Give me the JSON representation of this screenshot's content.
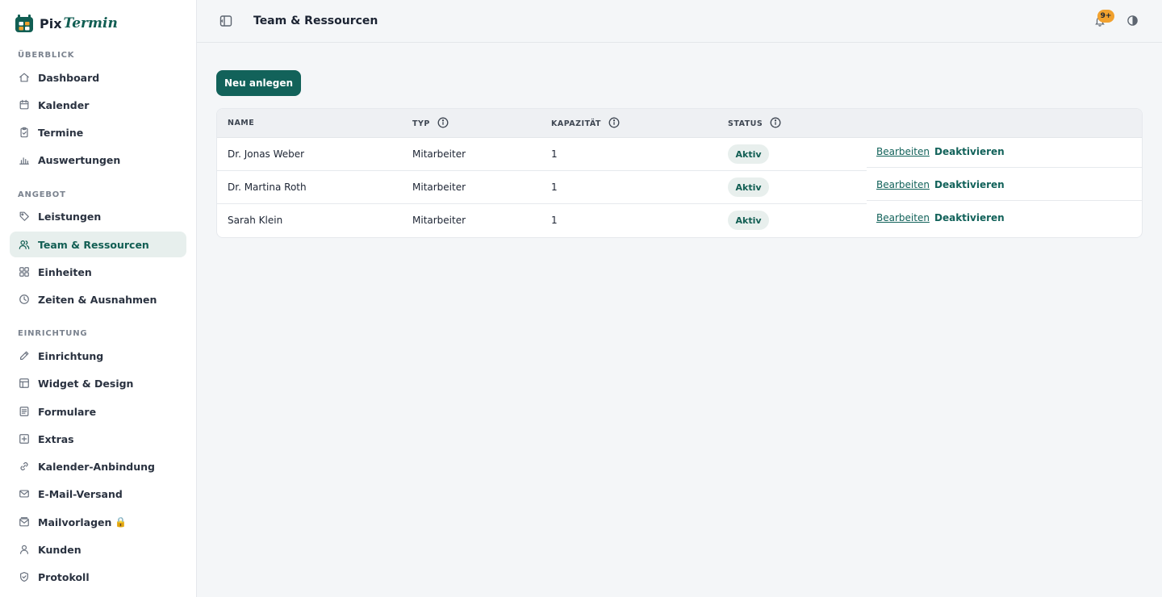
{
  "brand": {
    "name_part1": "Pix",
    "name_part2": "Termin"
  },
  "sidebar": {
    "sections": [
      {
        "title": "ÜBERBLICK"
      },
      {
        "title": "ANGEBOT"
      },
      {
        "title": "EINRICHTUNG"
      }
    ],
    "items": [
      {
        "label": "Dashboard",
        "icon": "home-icon"
      },
      {
        "label": "Kalender",
        "icon": "calendar-icon"
      },
      {
        "label": "Termine",
        "icon": "clipboard-icon"
      },
      {
        "label": "Auswertungen",
        "icon": "bar-chart-icon"
      },
      {
        "label": "Leistungen",
        "icon": "tag-icon"
      },
      {
        "label": "Team & Ressourcen",
        "icon": "users-icon",
        "active": true
      },
      {
        "label": "Einheiten",
        "icon": "grid-icon"
      },
      {
        "label": "Zeiten & Ausnahmen",
        "icon": "clock-icon"
      },
      {
        "label": "Einrichtung",
        "icon": "pencil-icon"
      },
      {
        "label": "Widget & Design",
        "icon": "layout-icon"
      },
      {
        "label": "Formulare",
        "icon": "form-icon"
      },
      {
        "label": "Extras",
        "icon": "plus-square-icon"
      },
      {
        "label": "Kalender-Anbindung",
        "icon": "link-icon"
      },
      {
        "label": "E-Mail-Versand",
        "icon": "mail-icon"
      },
      {
        "label": "Mailvorlagen",
        "icon": "mail-template-icon",
        "suffix": "🔒"
      },
      {
        "label": "Kunden",
        "icon": "user-icon"
      },
      {
        "label": "Protokoll",
        "icon": "shield-icon"
      }
    ]
  },
  "header": {
    "title": "Team & Ressourcen",
    "notification_badge": "9+"
  },
  "actions": {
    "new_button": "Neu anlegen"
  },
  "table": {
    "columns": [
      "NAME",
      "TYP",
      "KAPAZITÄT",
      "STATUS"
    ],
    "rows": [
      {
        "name": "Dr. Jonas Weber",
        "type": "Mitarbeiter",
        "capacity": "1",
        "status": "Aktiv",
        "edit": "Bearbeiten",
        "deactivate": "Deaktivieren"
      },
      {
        "name": "Dr. Martina Roth",
        "type": "Mitarbeiter",
        "capacity": "1",
        "status": "Aktiv",
        "edit": "Bearbeiten",
        "deactivate": "Deaktivieren"
      },
      {
        "name": "Sarah Klein",
        "type": "Mitarbeiter",
        "capacity": "1",
        "status": "Aktiv",
        "edit": "Bearbeiten",
        "deactivate": "Deaktivieren"
      }
    ]
  },
  "colors": {
    "accent": "#12625a",
    "badge": "#f1a12e",
    "active_bg": "#e7efed"
  }
}
